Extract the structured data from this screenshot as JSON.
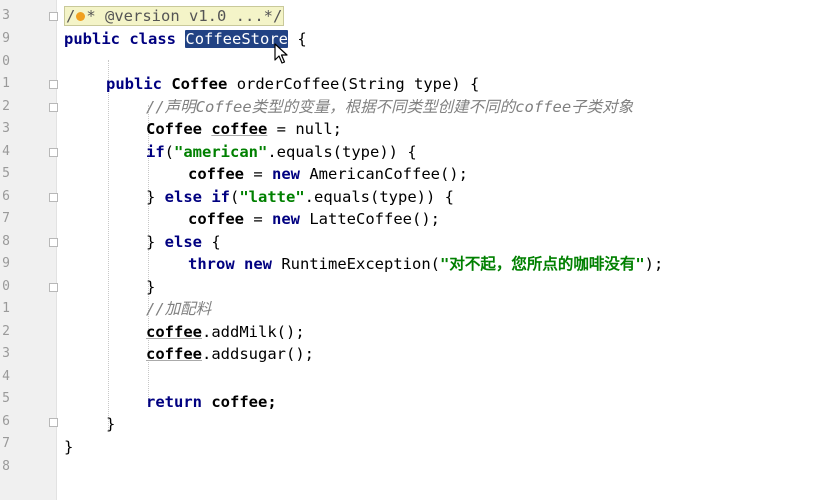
{
  "gutter": {
    "line_numbers": [
      "3",
      "9",
      "0",
      "1",
      "2",
      "3",
      "4",
      "5",
      "6",
      "7",
      "8",
      "9",
      "0",
      "1",
      "2",
      "3",
      "4",
      "5",
      "6",
      "7",
      "8"
    ]
  },
  "code": {
    "header_comment": {
      "slash": "/",
      "rest": "* @version v1.0 ...*/"
    },
    "class_decl": {
      "public": "public",
      "class": "class",
      "name": "CoffeeStore",
      "brace": " {"
    },
    "method_decl": {
      "public": "public",
      "type": "Coffee",
      "name": "orderCoffee",
      "params": "(String type) {"
    },
    "comment1": "//声明Coffee类型的变量，根据不同类型创建不同的coffee子类对象",
    "var_decl": {
      "type": "Coffee",
      "name": "coffee",
      "rest": " = null;"
    },
    "if_line": {
      "kw": "if",
      "open": "(",
      "str": "\"american\"",
      "rest": ".equals(type)) {"
    },
    "american_assign": {
      "name": "coffee",
      "eq": " = ",
      "kw": "new",
      "rest": " AmericanCoffee();"
    },
    "else_if_line": {
      "close": "} ",
      "kw": "else if",
      "open": "(",
      "str": "\"latte\"",
      "rest": ".equals(type)) {"
    },
    "latte_assign": {
      "name": "coffee",
      "eq": " = ",
      "kw": "new",
      "rest": " LatteCoffee();"
    },
    "else_line": {
      "close": "} ",
      "kw": "else",
      "rest": " {"
    },
    "throw_line": {
      "kw1": "throw",
      "kw2": "new",
      "cls": " RuntimeException(",
      "str": "\"对不起，您所点的咖啡没有\"",
      "rest": ");"
    },
    "close_else": "}",
    "comment2": "//加配料",
    "add_milk": {
      "name": "coffee",
      "rest": ".addMilk();"
    },
    "add_sugar": {
      "name": "coffee",
      "rest": ".addsugar();"
    },
    "return_line": {
      "kw": "return",
      "rest": " coffee;"
    },
    "close_method": "}",
    "close_class": "}"
  }
}
